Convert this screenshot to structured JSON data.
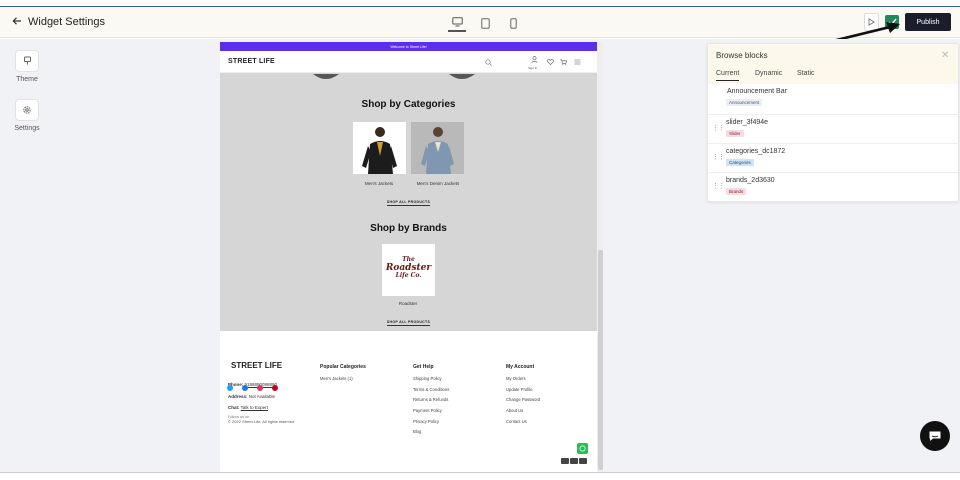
{
  "header": {
    "back_icon": "arrow-left-icon",
    "title": "Widget Settings",
    "devices": [
      "desktop",
      "tablet",
      "mobile"
    ],
    "publish_label": "Publish",
    "colors": {
      "publish_bg": "#1c1d2c",
      "saved_check": "#1d8b5c"
    }
  },
  "left_tools": [
    {
      "label": "Theme",
      "icon": "paint-bucket-icon"
    },
    {
      "label": "Settings",
      "icon": "gear-icon"
    }
  ],
  "preview": {
    "announcement": "Welcome to Street Life!",
    "announcement_color": "#5d2ef0",
    "logo": "STREET LIFE",
    "sign_in": "Sign In",
    "categories_title": "Shop by Categories",
    "categories": [
      "Men's Jackets",
      "Men's Denim Jackets"
    ],
    "shop_all_label": "SHOP ALL PRODUCTS",
    "brands_title": "Shop by Brands",
    "brand_logo_lines": [
      "The",
      "Roadster",
      "Life Co."
    ],
    "brands": [
      "Roadster"
    ],
    "footer": {
      "logo": "STREET LIFE",
      "phone_label": "Phone:",
      "phone": "9188890098890",
      "address_label": "Address:",
      "address": "Not Available",
      "chat_label": "Chat:",
      "chat_link": "Talk to Expert",
      "follow": "Follow us on",
      "columns": [
        {
          "title": "Popular Categories",
          "items": [
            "Men's Jackets (1)"
          ]
        },
        {
          "title": "Get Help",
          "items": [
            "Shipping Policy",
            "Terms & Conditions",
            "Returns & Refunds",
            "Payment Policy",
            "Privacy Policy",
            "Blog"
          ]
        },
        {
          "title": "My Account",
          "items": [
            "My Orders",
            "Update Profile",
            "Change Password",
            "About Us",
            "Contact Us"
          ]
        }
      ],
      "copyright": "© 2022 Street Life. All rights reserved"
    }
  },
  "panel": {
    "title": "Browse blocks",
    "tabs": [
      "Current",
      "Dynamic",
      "Static"
    ],
    "active_tab": "Current",
    "rows": [
      {
        "name": "Announcement Bar",
        "tag": "Announcement",
        "tag_color": "#e9eef6",
        "draggable": false
      },
      {
        "name": "slider_3f494e",
        "tag": "Slider",
        "tag_color": "#fadbe0",
        "draggable": true
      },
      {
        "name": "categories_dc1872",
        "tag": "Categories",
        "tag_color": "#cfe2f7",
        "draggable": true
      },
      {
        "name": "brands_2d3630",
        "tag": "Brands",
        "tag_color": "#fadbe0",
        "draggable": true
      }
    ]
  }
}
